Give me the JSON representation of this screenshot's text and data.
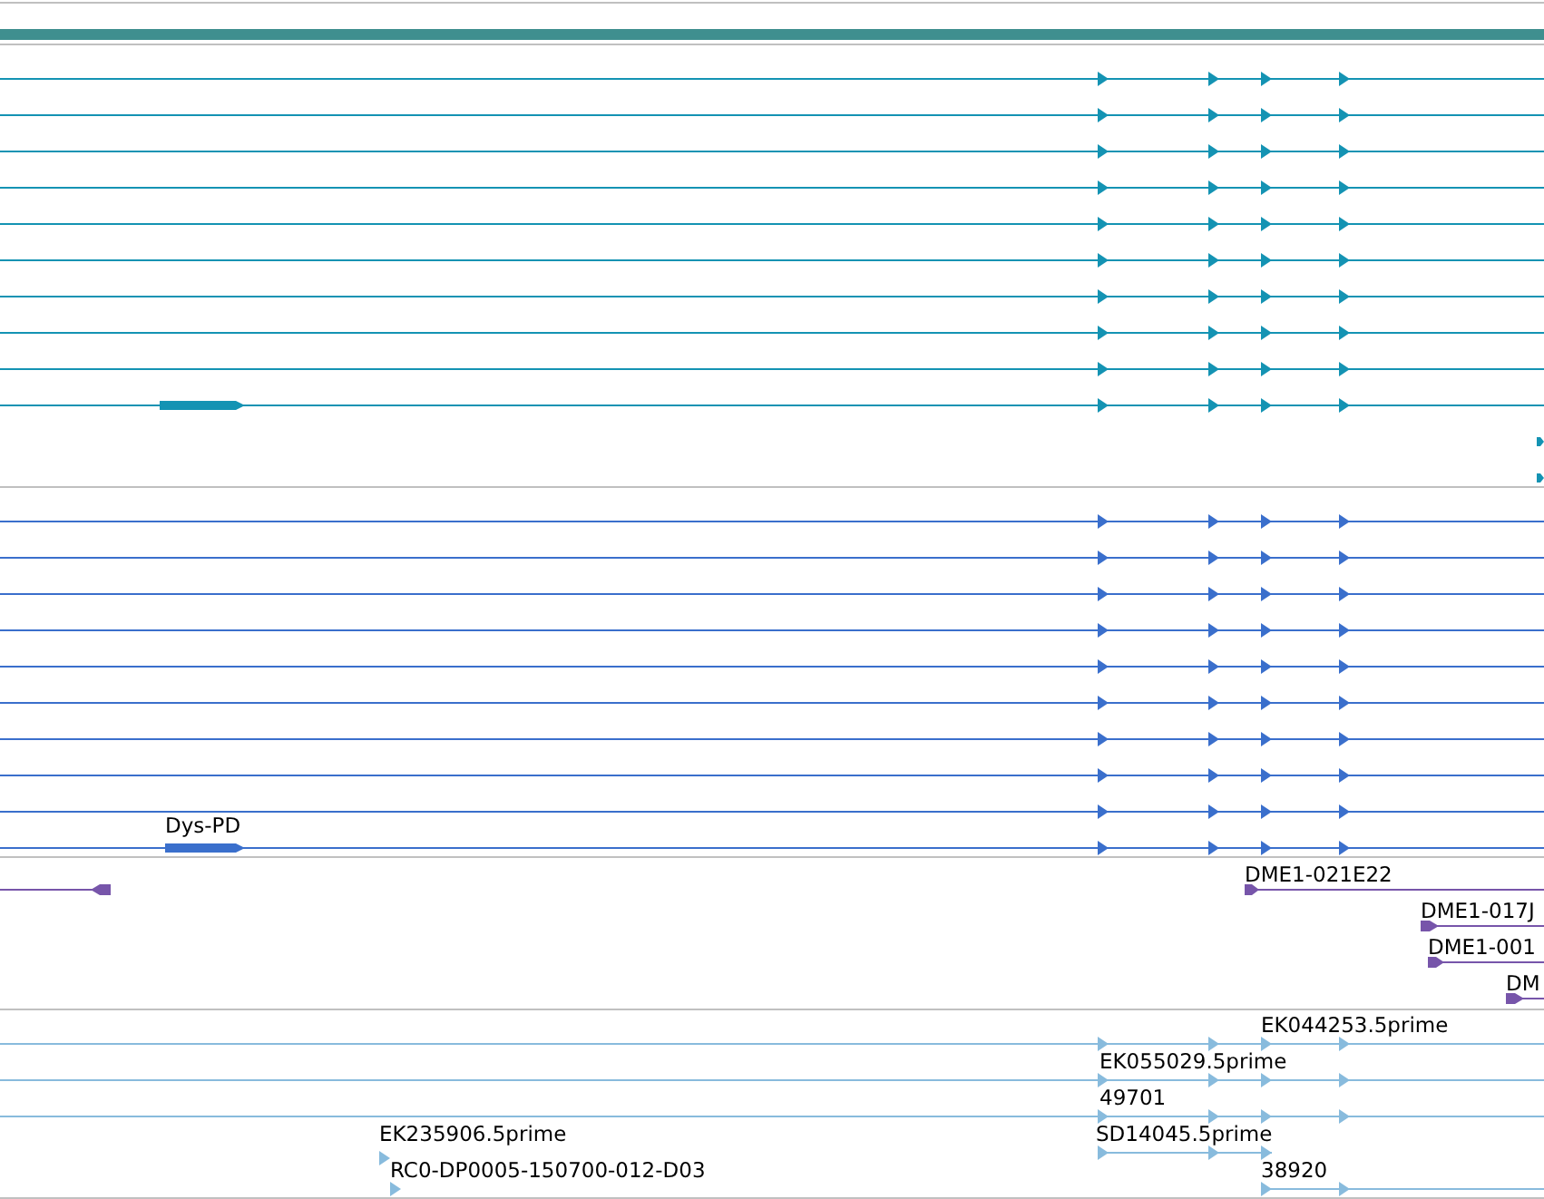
{
  "tracks": [
    {
      "kind": "transcript",
      "color": "#1493b3",
      "features": [
        {
          "exon": false
        },
        {
          "exon": false
        },
        {
          "exon": false
        },
        {
          "exon": false
        },
        {
          "exon": false
        },
        {
          "exon": false
        },
        {
          "exon": false
        },
        {
          "exon": false
        },
        {
          "exon": false
        },
        {
          "exon": true
        },
        {
          "exon": true
        },
        {
          "exon": true
        }
      ]
    },
    {
      "kind": "transcript",
      "color": "#3a6fcc",
      "features": [
        {
          "exon": false
        },
        {
          "exon": false
        },
        {
          "exon": false
        },
        {
          "exon": false
        },
        {
          "exon": false
        },
        {
          "exon": false
        },
        {
          "exon": false
        },
        {
          "exon": false
        },
        {
          "exon": false
        },
        {
          "exon": true,
          "label": "Dys-PD"
        }
      ]
    },
    {
      "kind": "clone",
      "color": "#7755aa",
      "features": [
        {
          "exon": true
        },
        {
          "exon": true,
          "label": "DME1-021E22"
        },
        {
          "exon": true,
          "label": "DME1-017J"
        },
        {
          "exon": true,
          "label": "DME1-001"
        },
        {
          "exon": true,
          "label": "DM"
        }
      ]
    },
    {
      "kind": "est",
      "color": "#88bbdd",
      "features": [
        {
          "label": "EK044253.5prime"
        },
        {
          "label": "EK055029.5prime"
        },
        {
          "label": "49701"
        },
        {
          "label": "EK235906.5prime"
        },
        {
          "label": "SD14045.5prime"
        },
        {
          "label": "RC0-DP0005-150700-012-D03"
        },
        {
          "label": "38920"
        }
      ]
    }
  ]
}
